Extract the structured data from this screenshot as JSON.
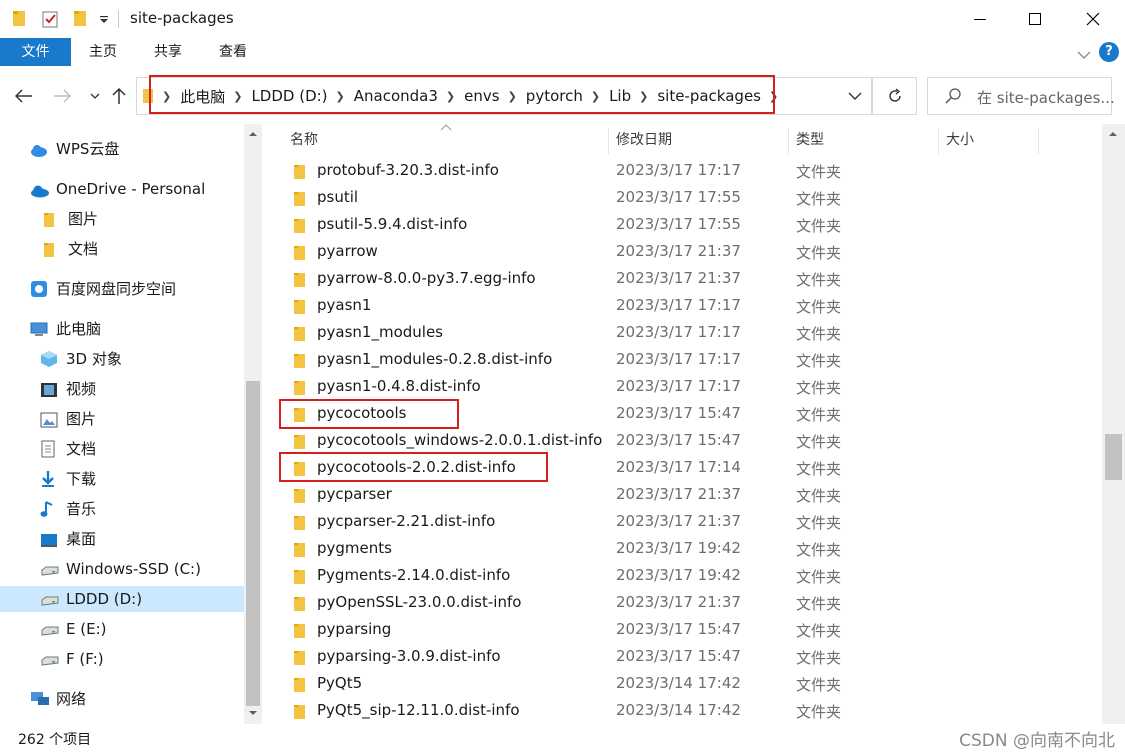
{
  "window": {
    "title": "site-packages"
  },
  "ribbon": {
    "tabs": [
      "文件",
      "主页",
      "共享",
      "查看"
    ],
    "help": "?"
  },
  "address": {
    "crumbs": [
      "此电脑",
      "LDDD (D:)",
      "Anaconda3",
      "envs",
      "pytorch",
      "Lib",
      "site-packages"
    ]
  },
  "search": {
    "placeholder": "在 site-packages..."
  },
  "nav": {
    "items": [
      {
        "label": "WPS云盘",
        "icon": "cloud-icon"
      },
      {
        "label": "OneDrive - Personal",
        "icon": "onedrive-icon"
      },
      {
        "label": "图片",
        "icon": "folder-icon"
      },
      {
        "label": "文档",
        "icon": "folder-icon"
      },
      {
        "label": "百度网盘同步空间",
        "icon": "baidu-icon"
      },
      {
        "label": "此电脑",
        "icon": "pc-icon"
      },
      {
        "label": "3D 对象",
        "icon": "cube-icon"
      },
      {
        "label": "视频",
        "icon": "video-icon"
      },
      {
        "label": "图片",
        "icon": "picture-icon"
      },
      {
        "label": "文档",
        "icon": "document-icon"
      },
      {
        "label": "下载",
        "icon": "download-icon"
      },
      {
        "label": "音乐",
        "icon": "music-icon"
      },
      {
        "label": "桌面",
        "icon": "desktop-icon"
      },
      {
        "label": "Windows-SSD (C:)",
        "icon": "drive-icon"
      },
      {
        "label": "LDDD (D:)",
        "icon": "drive-icon"
      },
      {
        "label": "E (E:)",
        "icon": "drive-icon"
      },
      {
        "label": "F (F:)",
        "icon": "drive-icon"
      },
      {
        "label": "网络",
        "icon": "network-icon"
      }
    ]
  },
  "columns": {
    "name": "名称",
    "date": "修改日期",
    "type": "类型",
    "size": "大小"
  },
  "files": [
    {
      "name": "protobuf-3.20.3.dist-info",
      "date": "2023/3/17 17:17",
      "type": "文件夹"
    },
    {
      "name": "psutil",
      "date": "2023/3/17 17:55",
      "type": "文件夹"
    },
    {
      "name": "psutil-5.9.4.dist-info",
      "date": "2023/3/17 17:55",
      "type": "文件夹"
    },
    {
      "name": "pyarrow",
      "date": "2023/3/17 21:37",
      "type": "文件夹"
    },
    {
      "name": "pyarrow-8.0.0-py3.7.egg-info",
      "date": "2023/3/17 21:37",
      "type": "文件夹"
    },
    {
      "name": "pyasn1",
      "date": "2023/3/17 17:17",
      "type": "文件夹"
    },
    {
      "name": "pyasn1_modules",
      "date": "2023/3/17 17:17",
      "type": "文件夹"
    },
    {
      "name": "pyasn1_modules-0.2.8.dist-info",
      "date": "2023/3/17 17:17",
      "type": "文件夹"
    },
    {
      "name": "pyasn1-0.4.8.dist-info",
      "date": "2023/3/17 17:17",
      "type": "文件夹"
    },
    {
      "name": "pycocotools",
      "date": "2023/3/17 15:47",
      "type": "文件夹"
    },
    {
      "name": "pycocotools_windows-2.0.0.1.dist-info",
      "date": "2023/3/17 15:47",
      "type": "文件夹"
    },
    {
      "name": "pycocotools-2.0.2.dist-info",
      "date": "2023/3/17 17:14",
      "type": "文件夹"
    },
    {
      "name": "pycparser",
      "date": "2023/3/17 21:37",
      "type": "文件夹"
    },
    {
      "name": "pycparser-2.21.dist-info",
      "date": "2023/3/17 21:37",
      "type": "文件夹"
    },
    {
      "name": "pygments",
      "date": "2023/3/17 19:42",
      "type": "文件夹"
    },
    {
      "name": "Pygments-2.14.0.dist-info",
      "date": "2023/3/17 19:42",
      "type": "文件夹"
    },
    {
      "name": "pyOpenSSL-23.0.0.dist-info",
      "date": "2023/3/17 21:37",
      "type": "文件夹"
    },
    {
      "name": "pyparsing",
      "date": "2023/3/17 15:47",
      "type": "文件夹"
    },
    {
      "name": "pyparsing-3.0.9.dist-info",
      "date": "2023/3/17 15:47",
      "type": "文件夹"
    },
    {
      "name": "PyQt5",
      "date": "2023/3/14 17:42",
      "type": "文件夹"
    },
    {
      "name": "PyQt5_sip-12.11.0.dist-info",
      "date": "2023/3/14 17:42",
      "type": "文件夹"
    }
  ],
  "status": {
    "count": "262 个项目",
    "watermark": "CSDN @向南不向北"
  },
  "colors": {
    "accent": "#1979ca",
    "highlight": "#d61f1f",
    "folder": "#f5c342",
    "selected": "#cce8ff"
  }
}
